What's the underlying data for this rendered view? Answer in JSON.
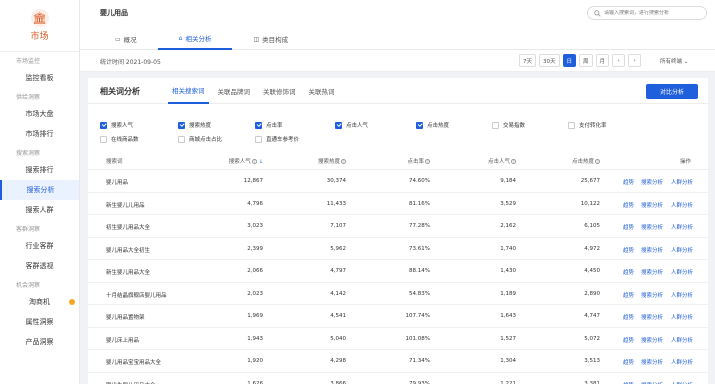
{
  "sidebar": {
    "logo_label": "市场",
    "groups": [
      {
        "title": "市场监控",
        "items": [
          {
            "label": "监控看板"
          }
        ]
      },
      {
        "title": "供给洞察",
        "items": [
          {
            "label": "市场大盘"
          },
          {
            "label": "市场排行"
          }
        ]
      },
      {
        "title": "搜索洞察",
        "items": [
          {
            "label": "搜索排行"
          },
          {
            "label": "搜索分析"
          },
          {
            "label": "搜索人群"
          }
        ]
      },
      {
        "title": "客群洞察",
        "items": [
          {
            "label": "行业客群"
          },
          {
            "label": "客群透视"
          }
        ]
      },
      {
        "title": "机会洞察",
        "items": [
          {
            "label": "淘商机"
          },
          {
            "label": "属性洞察"
          },
          {
            "label": "产品洞察"
          }
        ]
      }
    ],
    "active_item": "搜索分析"
  },
  "header": {
    "title": "婴儿用品",
    "search_placeholder": "请输入搜索词，进行搜索分析",
    "tabs": [
      {
        "label": "概况",
        "icon": "file-icon"
      },
      {
        "label": "相关分析",
        "icon": "home-icon",
        "active": true
      },
      {
        "label": "类目构成",
        "icon": "bag-icon"
      }
    ]
  },
  "statbar": {
    "time": "统计时间 2021-09-05",
    "periods": [
      "7天",
      "30天",
      "日",
      "周",
      "月"
    ],
    "active_period": "日",
    "terminal": "所有终端"
  },
  "panel": {
    "title": "相关词分析",
    "subtabs": [
      "相关搜索词",
      "关联品牌词",
      "关联修饰词",
      "关联热词"
    ],
    "active_subtab": "相关搜索词",
    "compare_button": "对比分析",
    "checkboxes": [
      {
        "label": "搜索人气",
        "checked": true
      },
      {
        "label": "搜索热度",
        "checked": true
      },
      {
        "label": "点击率",
        "checked": true
      },
      {
        "label": "点击人气",
        "checked": true
      },
      {
        "label": "点击热度",
        "checked": true
      },
      {
        "label": "交易指数",
        "checked": false
      },
      {
        "label": "支付转化率",
        "checked": false
      },
      {
        "label": "在线商品数",
        "checked": false
      },
      {
        "label": "商城点击占比",
        "checked": false
      },
      {
        "label": "直通车参考价",
        "checked": false
      }
    ]
  },
  "table": {
    "columns": [
      "搜索词",
      "搜索人气",
      "搜索热度",
      "点击率",
      "点击人气",
      "点击热度",
      "操作"
    ],
    "sorted_column": "搜索人气",
    "actions": [
      "趋势",
      "搜索分析",
      "人群分析"
    ],
    "rows": [
      [
        "婴儿用品",
        "12,867",
        "30,374",
        "74.60%",
        "9,184",
        "25,677"
      ],
      [
        "新生婴儿儿用品",
        "4,796",
        "11,433",
        "81.16%",
        "3,529",
        "10,122"
      ],
      [
        "初生婴儿用品大全",
        "3,023",
        "7,107",
        "77.28%",
        "2,162",
        "6,105"
      ],
      [
        "婴儿用品大全初生",
        "2,399",
        "5,962",
        "73.61%",
        "1,740",
        "4,972"
      ],
      [
        "新生婴儿用品大全",
        "2,066",
        "4,797",
        "88.14%",
        "1,430",
        "4,450"
      ],
      [
        "十月结晶旗舰店婴儿用品",
        "2,023",
        "4,142",
        "54.83%",
        "1,189",
        "2,890"
      ],
      [
        "婴儿用品置物架",
        "1,969",
        "4,541",
        "107.74%",
        "1,643",
        "4,747"
      ],
      [
        "婴儿床上用品",
        "1,943",
        "5,040",
        "101.08%",
        "1,527",
        "5,072"
      ],
      [
        "婴儿用品宝宝用品大全",
        "1,920",
        "4,298",
        "71.34%",
        "1,304",
        "3,513"
      ],
      [
        "刚出生婴儿用品大全",
        "1,626",
        "3,866",
        "79.93%",
        "1,221",
        "3,381"
      ]
    ]
  },
  "colors": {
    "accent": "#1f5fdb",
    "brand": "#d9531e",
    "dot": "#f5a623"
  }
}
